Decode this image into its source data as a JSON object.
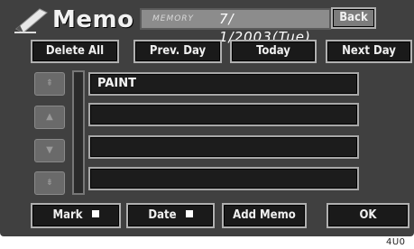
{
  "header": {
    "title": "Memo",
    "date_label": "MEMORY",
    "date_value": "7/ 1/2003(Tue)",
    "back_label": "Back"
  },
  "nav": {
    "delete_all": "Delete All",
    "prev_day": "Prev. Day",
    "today": "Today",
    "next_day": "Next Day"
  },
  "memos": [
    {
      "text": "PAINT"
    },
    {
      "text": ""
    },
    {
      "text": ""
    },
    {
      "text": ""
    }
  ],
  "footer": {
    "mark": "Mark",
    "date": "Date",
    "add_memo": "Add Memo",
    "ok": "OK"
  },
  "figure_code": "4U0"
}
